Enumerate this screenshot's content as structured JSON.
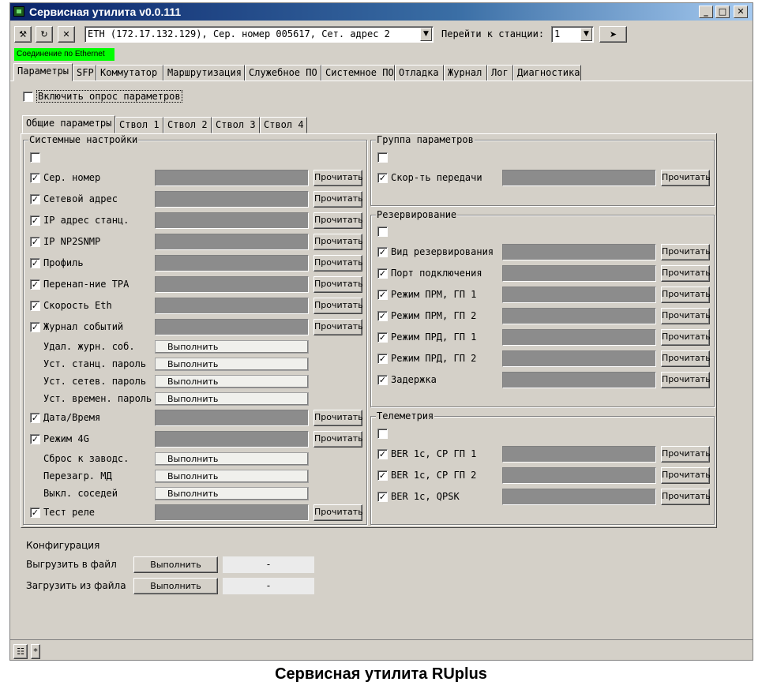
{
  "window": {
    "title": "Сервисная утилита v0.0.111",
    "minimize": "_",
    "maximize": "□",
    "close": "✕"
  },
  "toolbar": {
    "btn_tools": "⚒",
    "btn_refresh": "↻",
    "btn_close": "✕",
    "connection_value": "ETH (172.17.132.129), Сер. номер 005617, Сет. адрес 2",
    "goto_label": "Перейти к станции:",
    "station_value": "1",
    "go_button": "➤",
    "combo_arrow": "▼"
  },
  "status": {
    "connection": "Соединение по Ethernet"
  },
  "main_tabs": [
    "Параметры",
    "SFP",
    "Коммутатор",
    "Маршрутизация",
    "Служебное ПО",
    "Системное ПО",
    "Отладка",
    "Журнал",
    "Лог",
    "Диагностика"
  ],
  "enable_polling": {
    "label": "Включить опрос параметров",
    "checked": false
  },
  "sub_tabs": [
    "Общие параметры",
    "Ствол 1",
    "Ствол 2",
    "Ствол 3",
    "Ствол 4"
  ],
  "read_label": "Прочитать",
  "exec_label": "Выполнить",
  "check_mark": "✓",
  "system": {
    "title": "Системные настройки",
    "rows": [
      {
        "type": "read",
        "label": "Сер. номер"
      },
      {
        "type": "read",
        "label": "Сетевой адрес"
      },
      {
        "type": "read",
        "label": "IP адрес станц."
      },
      {
        "type": "read",
        "label": "IP NP2SNMP"
      },
      {
        "type": "read",
        "label": "Профиль"
      },
      {
        "type": "read",
        "label": "Перенап-ние TPA"
      },
      {
        "type": "read",
        "label": "Скорость Eth"
      },
      {
        "type": "read",
        "label": "Журнал событий"
      },
      {
        "type": "exec",
        "label": "Удал. журн. соб."
      },
      {
        "type": "exec",
        "label": "Уст. станц. пароль"
      },
      {
        "type": "exec",
        "label": "Уст. сетев. пароль"
      },
      {
        "type": "exec",
        "label": "Уст. времен. пароль"
      },
      {
        "type": "read",
        "label": "Дата/Время"
      },
      {
        "type": "read",
        "label": "Режим 4G"
      },
      {
        "type": "exec",
        "label": "Сброс к заводс."
      },
      {
        "type": "exec",
        "label": "Перезагр. МД"
      },
      {
        "type": "exec",
        "label": "Выкл. соседей"
      },
      {
        "type": "read",
        "label": "Тест реле"
      }
    ]
  },
  "param_group": {
    "title": "Группа параметров",
    "rows": [
      {
        "label": "Скор-ть передачи"
      }
    ]
  },
  "redundancy": {
    "title": "Резервирование",
    "rows": [
      {
        "label": "Вид резервирования"
      },
      {
        "label": "Порт подключения"
      },
      {
        "label": "Режим ПРМ, ГП 1"
      },
      {
        "label": "Режим ПРМ, ГП 2"
      },
      {
        "label": "Режим ПРД, ГП 1"
      },
      {
        "label": "Режим ПРД, ГП 2"
      },
      {
        "label": "Задержка"
      }
    ]
  },
  "telemetry": {
    "title": "Телеметрия",
    "rows": [
      {
        "label": "BER 1c, СР ГП 1"
      },
      {
        "label": "BER 1c, СР ГП 2"
      },
      {
        "label": "BER 1c, QPSK"
      }
    ]
  },
  "config": {
    "title": "Конфигурация",
    "export_label": "Выгрузить в файл",
    "import_label": "Загрузить из файла",
    "export_value": "-",
    "import_value": "-"
  },
  "statusbar": {
    "btn1": "☷",
    "btn2": "*"
  },
  "caption": "Сервисная утилита RUplus"
}
